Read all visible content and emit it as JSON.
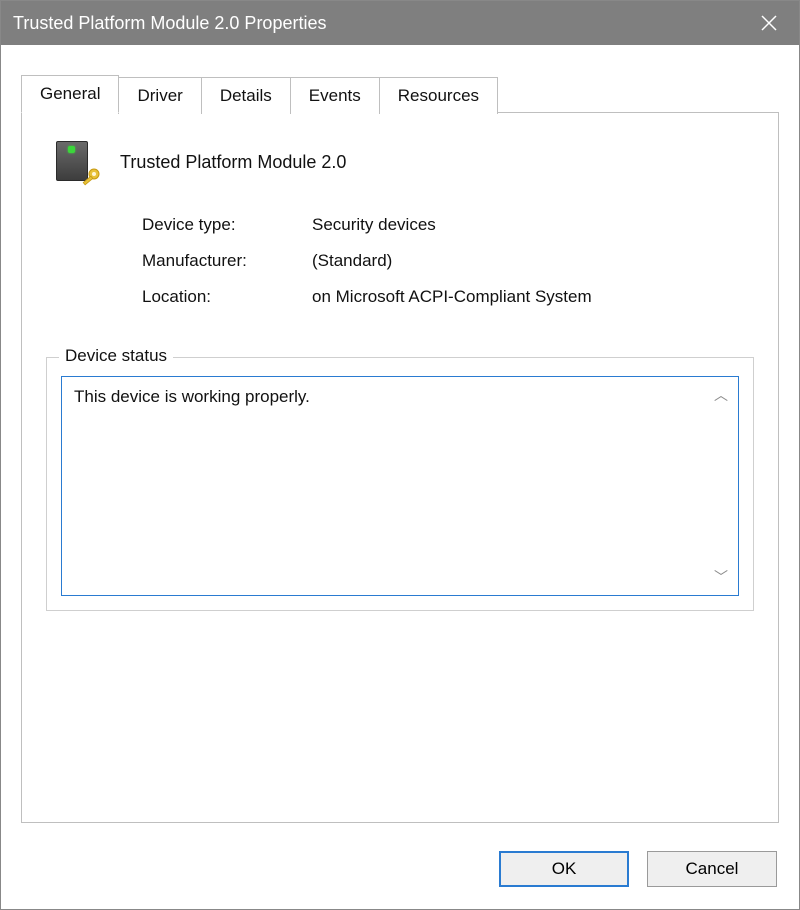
{
  "window": {
    "title": "Trusted Platform Module 2.0 Properties"
  },
  "tabs": {
    "general": "General",
    "driver": "Driver",
    "details": "Details",
    "events": "Events",
    "resources": "Resources"
  },
  "device": {
    "name": "Trusted Platform Module 2.0",
    "type_label": "Device type:",
    "type_value": "Security devices",
    "manufacturer_label": "Manufacturer:",
    "manufacturer_value": "(Standard)",
    "location_label": "Location:",
    "location_value": "on Microsoft ACPI-Compliant System"
  },
  "status": {
    "legend": "Device status",
    "text": "This device is working properly."
  },
  "buttons": {
    "ok": "OK",
    "cancel": "Cancel"
  }
}
